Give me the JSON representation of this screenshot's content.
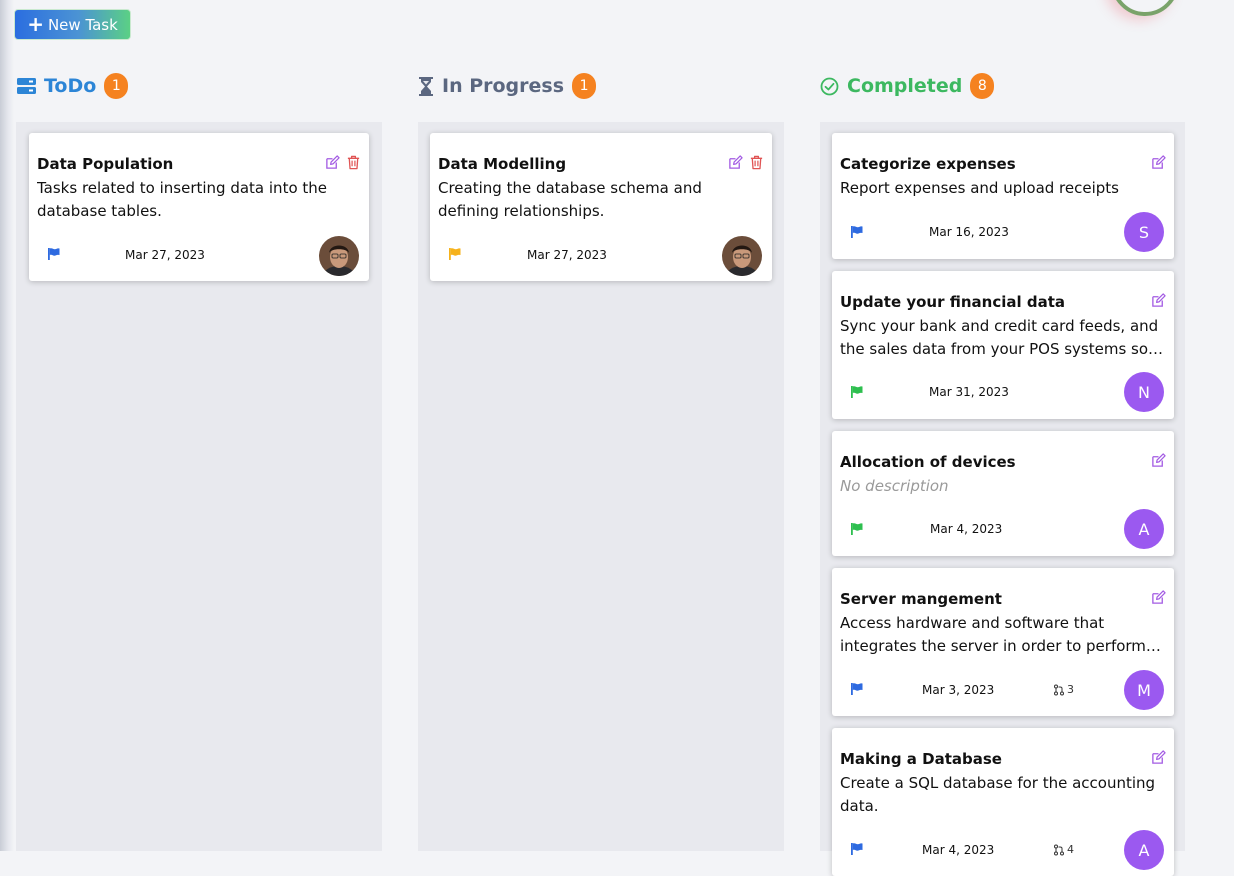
{
  "toolbar": {
    "new_task_label": "New Task",
    "plus": "+"
  },
  "colors": {
    "todo": "#2c85d6",
    "in_progress": "#5b6780",
    "completed": "#3cb860",
    "badge": "#f58220",
    "avatar_letter": "#9b59f0",
    "flag_blue": "#2e6ae0",
    "flag_yellow": "#f6b21b",
    "flag_green": "#2ebf4f",
    "edit_icon": "#a35be3",
    "delete_icon": "#e05454"
  },
  "columns": [
    {
      "title": "ToDo",
      "count": "1",
      "icon": "storage-icon",
      "cards": [
        {
          "title": "Data Population",
          "description": "Tasks related to inserting data into the database tables.",
          "date": "Mar 27, 2023",
          "flag": "blue",
          "avatar": "photo"
        }
      ]
    },
    {
      "title": "In Progress",
      "count": "1",
      "icon": "hourglass-icon",
      "cards": [
        {
          "title": "Data Modelling",
          "description": "Creating the database schema and defining relationships.",
          "date": "Mar 27, 2023",
          "flag": "yellow",
          "avatar": "photo"
        }
      ]
    },
    {
      "title": "Completed",
      "count": "8",
      "icon": "check-circle-icon",
      "cards": [
        {
          "title": "Categorize expenses",
          "description": "Report expenses and upload receipts",
          "date": "Mar 16, 2023",
          "flag": "blue",
          "avatar": "S"
        },
        {
          "title": "Update your financial data",
          "description": "Sync your bank and credit card feeds, and the sales data from your POS systems so everything is up to date.",
          "date": "Mar 31, 2023",
          "flag": "green",
          "avatar": "N"
        },
        {
          "title": "Allocation of devices",
          "description": "No description",
          "date": "Mar 4, 2023",
          "flag": "green",
          "avatar": "A"
        },
        {
          "title": "Server mangement",
          "description": "Access hardware and software that integrates the server in order to perform its functions reliably.",
          "date": "Mar 3, 2023",
          "flag": "blue",
          "avatar": "M",
          "subtasks": "3"
        },
        {
          "title": "Making a Database",
          "description": "Create a SQL database for the accounting data.",
          "date": "Mar 4, 2023",
          "flag": "blue",
          "avatar": "A",
          "subtasks": "4"
        }
      ]
    }
  ]
}
